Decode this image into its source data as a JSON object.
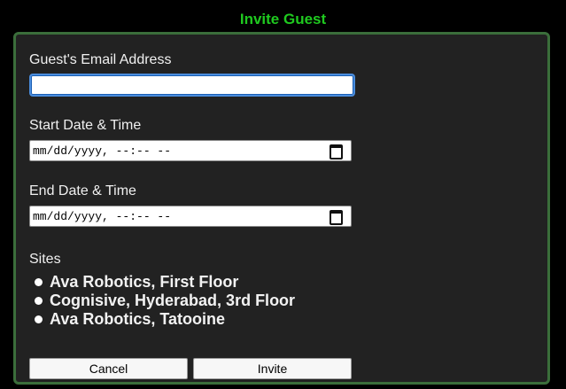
{
  "dialog": {
    "title": "Invite Guest"
  },
  "email": {
    "label": "Guest's Email Address",
    "value": ""
  },
  "start": {
    "label": "Start Date & Time",
    "value": "mm/dd/yyyy, --:-- --",
    "icon": "calendar-icon"
  },
  "end": {
    "label": "End Date & Time",
    "value": "mm/dd/yyyy, --:-- --",
    "icon": "calendar-icon"
  },
  "sites": {
    "label": "Sites",
    "items": [
      {
        "label": "Ava Robotics, First Floor"
      },
      {
        "label": "Cognisive, Hyderabad, 3rd Floor"
      },
      {
        "label": "Ava Robotics, Tatooine"
      }
    ]
  },
  "buttons": {
    "cancel_label": "Cancel",
    "invite_label": "Invite"
  },
  "colors": {
    "title": "#1fc91f",
    "panel_border": "#3b6e3b",
    "panel_background": "#222222",
    "focus_ring": "#4a8cdc"
  }
}
